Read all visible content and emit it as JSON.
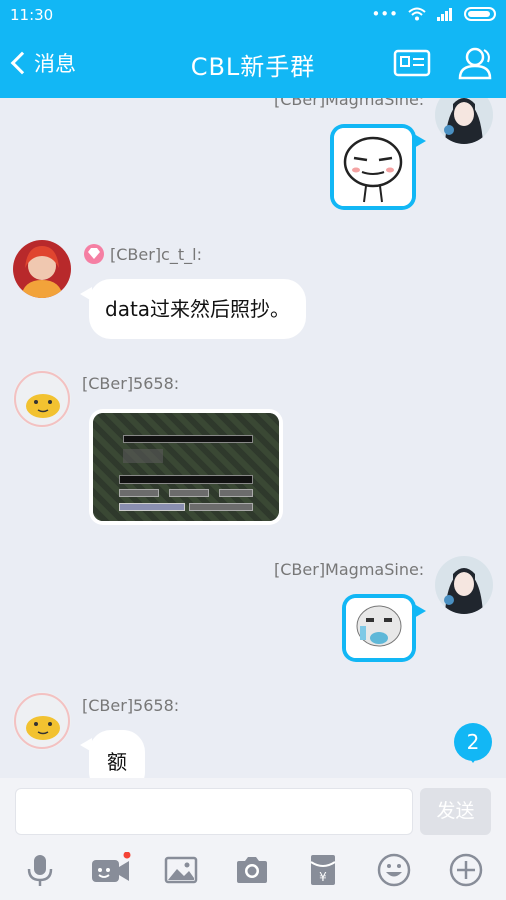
{
  "status": {
    "time": "11:30"
  },
  "header": {
    "back_label": "消息",
    "title": "CBL新手群"
  },
  "messages": [
    {
      "sender": "[CBer]MagmaSine:",
      "type": "sticker"
    },
    {
      "sender": "[CBer]c_t_l:",
      "type": "text",
      "text": "data过来然后照抄。"
    },
    {
      "sender": "[CBer]5658:",
      "type": "image"
    },
    {
      "sender": "[CBer]MagmaSine:",
      "type": "sticker"
    },
    {
      "sender": "[CBer]5658:",
      "type": "text",
      "text": "额"
    }
  ],
  "unread_count": "2",
  "composer": {
    "input_value": "",
    "send_label": "发送"
  },
  "toolbar": [
    "microphone-icon",
    "video-call-icon",
    "image-icon",
    "camera-icon",
    "red-packet-icon",
    "emoji-icon",
    "plus-icon"
  ],
  "colors": {
    "accent": "#12b7f5",
    "background": "#eaedf4",
    "badge_dot": "#f44336"
  }
}
